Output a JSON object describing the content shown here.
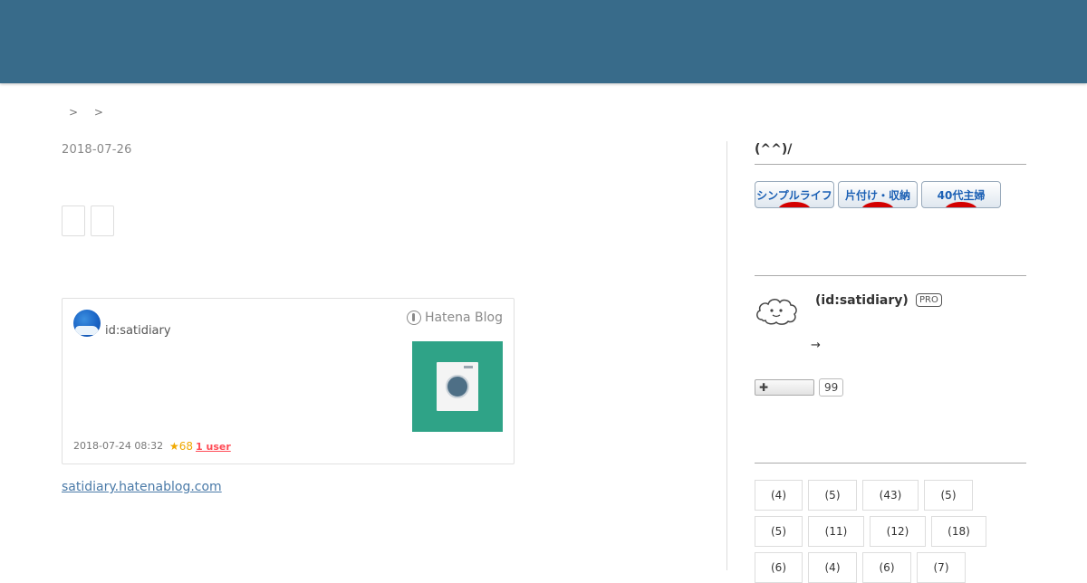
{
  "breadcrumb": {
    "separators": [
      ">",
      ">"
    ]
  },
  "entry": {
    "date": "2018-07-26"
  },
  "embed": {
    "user": "id:satidiary",
    "brand": "Hatena Blog",
    "date": "2018-07-24 08:32",
    "stars": "★68",
    "users": "1 user"
  },
  "site_link": "satidiary.hatenablog.com",
  "sidebar": {
    "section1_title": "(^^)/",
    "banners": [
      "シンプルライフ",
      "片付け・収納",
      "40代主婦"
    ],
    "profile": {
      "name": "(id:satidiary)",
      "badge": "PRO",
      "arrow": "→",
      "follow_icon": "✚",
      "follow_count": "99"
    },
    "tags": [
      "(4)",
      "(5)",
      "(43)",
      "(5)",
      "(5)",
      "(11)",
      "(12)",
      "(18)",
      "(6)",
      "(4)",
      "(6)",
      "(7)"
    ]
  }
}
